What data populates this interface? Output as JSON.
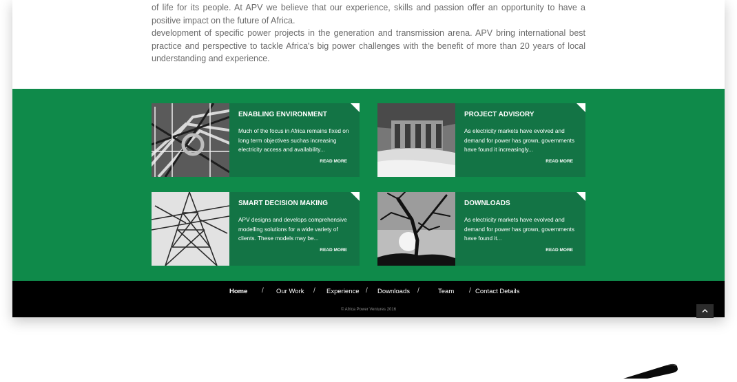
{
  "intro": {
    "line1": "of life for its people. At APV we believe that our experience, skills and passion offer an opportunity to have a positive impact on the future of Africa.",
    "line2": "development of specific power projects in the generation and transmission arena. APV bring international best practice and perspective to tackle Africa's big power challenges with the benefit of more than 20 years of local understanding and experience."
  },
  "cards": [
    {
      "title": "ENABLING ENVIRONMENT",
      "text": "Much of the focus in Africa remains fixed on long term objectives suchas increasing electricity access and availability...",
      "more": "READ MORE"
    },
    {
      "title": "PROJECT ADVISORY",
      "text": "As electricity markets have evolved and demand for power has grown, governments have found it increasingly...",
      "more": "READ MORE"
    },
    {
      "title": "SMART DECISION MAKING",
      "text": "APV designs and develops comprehensive modelling solutions for a wide variety of clients. These models may be...",
      "more": "READ MORE"
    },
    {
      "title": "DOWNLOADS",
      "text": "As electricity markets have evolved and demand for power has grown, governments have found it...",
      "more": "READ MORE"
    }
  ],
  "nav": [
    {
      "label": "Home",
      "active": true
    },
    {
      "label": "Our Work"
    },
    {
      "label": "Experience"
    },
    {
      "label": "Downloads"
    },
    {
      "label": "Team"
    },
    {
      "label": "Contact Details"
    }
  ],
  "nav_separator": "/",
  "copyright": "© Africa Power Ventures 2016",
  "colors": {
    "band_green": "#0f8a4a",
    "card_green": "#137445",
    "footer_black": "#000000",
    "body_text": "#6b6b6b"
  },
  "icons": {
    "back_to_top": "chevron-up-icon",
    "card_corner": "corner-fold-icon"
  }
}
